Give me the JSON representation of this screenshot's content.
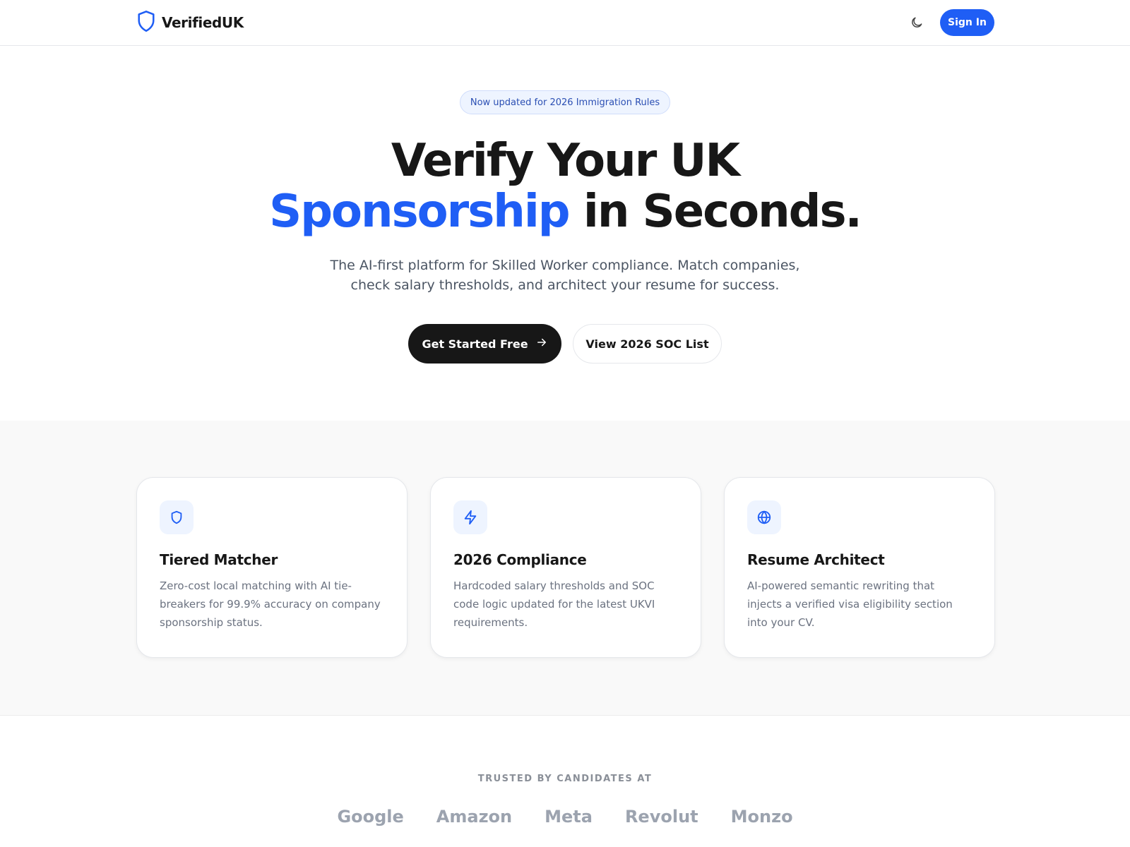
{
  "header": {
    "brand": "VerifiedUK",
    "signin_label": "Sign In"
  },
  "hero": {
    "badge": "Now updated for 2026 Immigration Rules",
    "title_line1": "Verify Your UK",
    "title_accent": "Sponsorship",
    "title_rest": " in Seconds.",
    "subtitle_line1": "The AI-first platform for Skilled Worker compliance. Match companies,",
    "subtitle_line2": "check salary thresholds, and architect your resume for success.",
    "primary_cta": "Get Started Free",
    "secondary_cta": "View 2026 SOC List"
  },
  "features": [
    {
      "icon": "shield-icon",
      "title": "Tiered Matcher",
      "description": "Zero-cost local matching with AI tie-breakers for 99.9% accuracy on company sponsorship status."
    },
    {
      "icon": "lightning-icon",
      "title": "2026 Compliance",
      "description": "Hardcoded salary thresholds and SOC code logic updated for the latest UKVI requirements."
    },
    {
      "icon": "globe-icon",
      "title": "Resume Architect",
      "description": "AI-powered semantic rewriting that injects a verified visa eligibility section into your CV."
    }
  ],
  "trusted": {
    "label": "TRUSTED BY CANDIDATES AT",
    "companies": [
      "Google",
      "Amazon",
      "Meta",
      "Revolut",
      "Monzo"
    ]
  },
  "colors": {
    "accent": "#1f5ef5",
    "dark": "#171717",
    "muted": "#6b7280"
  }
}
